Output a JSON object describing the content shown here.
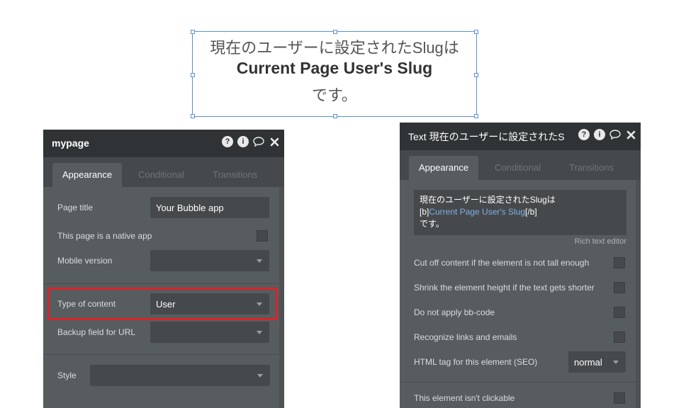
{
  "canvas_text": {
    "line1": "現在のユーザーに設定されたSlugは",
    "line2": "Current Page User's Slug",
    "line3": "です。"
  },
  "left_panel": {
    "title": "mypage",
    "tabs": [
      "Appearance",
      "Conditional",
      "Transitions"
    ],
    "page_title_label": "Page title",
    "page_title_value": "Your Bubble app",
    "native_app_label": "This page is a native app",
    "mobile_version_label": "Mobile version",
    "mobile_version_value": "",
    "type_of_content_label": "Type of content",
    "type_of_content_value": "User",
    "backup_field_label": "Backup field for URL",
    "backup_field_value": "",
    "style_label": "Style",
    "style_value": ""
  },
  "right_panel": {
    "title": "Text 現在のユーザーに設定されたS",
    "tabs": [
      "Appearance",
      "Conditional",
      "Transitions"
    ],
    "rte_line1": "現在のユーザーに設定されたSlugは",
    "rte_open_tag": "[b]",
    "rte_dynamic": "Current Page User's Slug",
    "rte_close_tag": "[/b]",
    "rte_line3": "です。",
    "rich_text_editor_label": "Rich text editor",
    "cut_off_label": "Cut off content if the element is not tall enough",
    "shrink_label": "Shrink the element height if the text gets shorter",
    "no_bbcode_label": "Do not apply bb-code",
    "recognize_links_label": "Recognize links and emails",
    "html_tag_label": "HTML tag for this element (SEO)",
    "html_tag_value": "normal",
    "not_clickable_label": "This element isn't clickable"
  },
  "icons": [
    "help-icon",
    "info-icon",
    "comment-icon",
    "close-icon",
    "chevron-down-icon"
  ],
  "colors": {
    "selection": "#5b8fd6",
    "highlight": "#d9242a",
    "dynamic_text": "#7fb0e8"
  }
}
